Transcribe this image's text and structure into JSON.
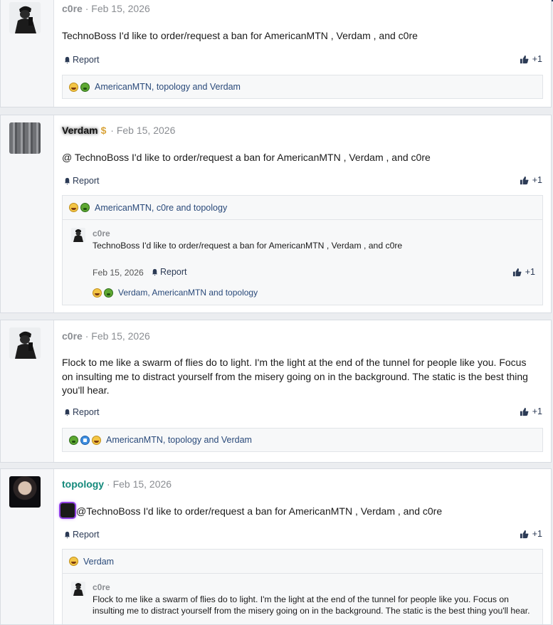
{
  "posts": [
    {
      "author": "c0re",
      "sep": " · ",
      "date": "Feb 15, 2026",
      "text": "TechnoBoss I'd like to order/request a ban for AmericanMTN , Verdam , and c0re",
      "report": "Report",
      "likes": "+1",
      "reactions": "AmericanMTN, topology and Verdam"
    },
    {
      "author": "Verdam",
      "badge": "$",
      "sep": " · ",
      "date": "Feb 15, 2026",
      "text": "@ TechnoBoss I'd like to order/request a ban for AmericanMTN , Verdam , and c0re",
      "report": "Report",
      "likes": "+1",
      "reactions": "AmericanMTN, c0re and topology",
      "quote": {
        "author": "c0re",
        "text": "TechnoBoss I'd like to order/request a ban for AmericanMTN , Verdam , and c0re",
        "date": "Feb 15, 2026",
        "report": "Report",
        "likes": "+1",
        "reactions": "Verdam, AmericanMTN and topology"
      }
    },
    {
      "author": "c0re",
      "sep": " · ",
      "date": "Feb 15, 2026",
      "text": "Flock to me like a swarm of flies do to light. I'm the light at the end of the tunnel for people like you. Focus on insulting me to distract yourself from the misery going on in the background. The static is the best thing you'll hear.",
      "report": "Report",
      "likes": "+1",
      "reactions": "AmericanMTN, topology and Verdam"
    },
    {
      "author": "topology",
      "sep": " · ",
      "date": "Feb 15, 2026",
      "text": "@TechnoBoss I'd like to order/request a ban for AmericanMTN , Verdam , and c0re",
      "report": "Report",
      "likes": "+1",
      "quote": {
        "reactions": "Verdam",
        "author": "c0re",
        "text": "Flock to me like a swarm of flies do to light. I'm the light at the end of the tunnel for people like you. Focus on insulting me to distract yourself from the misery going on in the background. The static is the best thing you'll hear."
      }
    }
  ],
  "icons": {
    "report": "bell-icon",
    "like": "thumbs-up-icon",
    "laugh": "laughing-emoji-icon",
    "sick": "sick-emoji-icon",
    "thumb": "like-emoji-icon"
  },
  "colors": {
    "accent": "#2b3a55",
    "topology_name": "#13897b",
    "badge": "#d9a43a"
  }
}
